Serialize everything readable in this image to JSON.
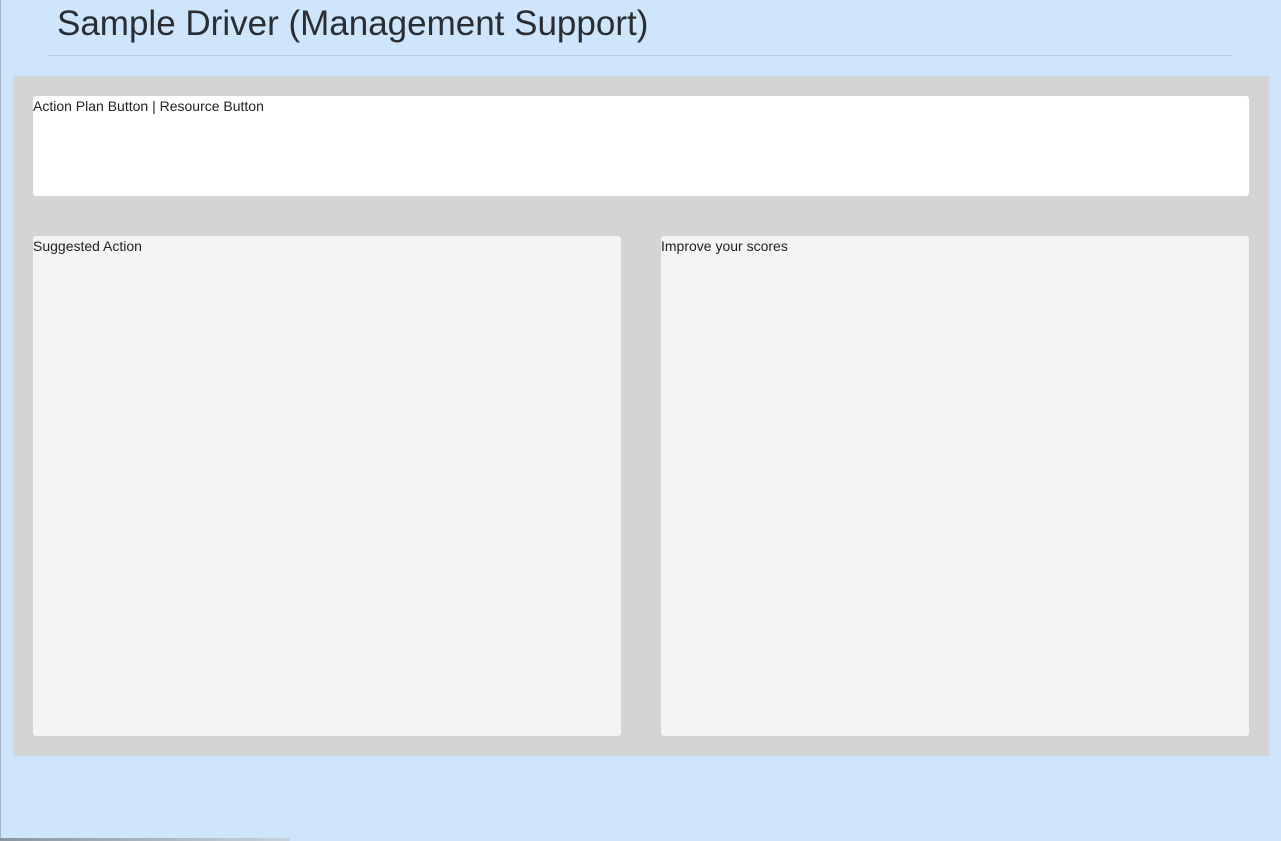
{
  "header": {
    "title": "Sample Driver (Management Support)"
  },
  "action_bar": {
    "label": "Action Plan Button | Resource Button"
  },
  "panels": {
    "suggested_action": {
      "label": "Suggested Action"
    },
    "improve_scores": {
      "label": "Improve your scores"
    }
  },
  "colors": {
    "page_background": "#cfe5fb",
    "content_background": "#d4d4d4",
    "action_bar_background": "#ffffff",
    "panel_background": "#f4f4f4"
  }
}
